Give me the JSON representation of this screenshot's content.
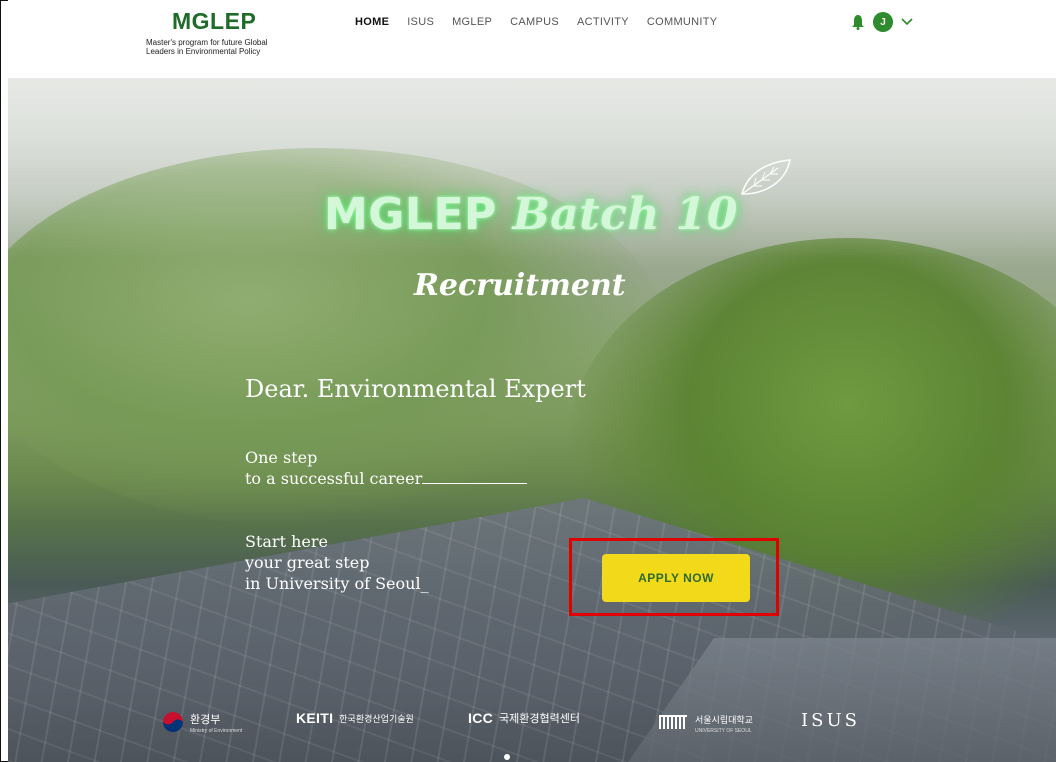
{
  "header": {
    "logo_title": "MGLEP",
    "logo_subtitle_line1": "Master's program for future Global",
    "logo_subtitle_line2": "Leaders in Environmental Policy",
    "nav": [
      {
        "label": "HOME",
        "active": true
      },
      {
        "label": "ISUS",
        "active": false
      },
      {
        "label": "MGLEP",
        "active": false
      },
      {
        "label": "CAMPUS",
        "active": false
      },
      {
        "label": "ACTIVITY",
        "active": false
      },
      {
        "label": "COMMUNITY",
        "active": false
      }
    ],
    "user_initial": "J",
    "icons": [
      "bell-icon",
      "avatar",
      "chevron-down-icon"
    ]
  },
  "hero": {
    "title_part1": "MGLEP",
    "title_part2": "Batch 10",
    "subtitle": "Recruitment",
    "greeting": "Dear. Environmental Expert",
    "step_line1": "One step",
    "step_line2": "to a successful career",
    "start_line1": "Start here",
    "start_line2": "your great step",
    "start_line3": "in University of Seoul_",
    "apply_label": "APPLY NOW"
  },
  "partners": {
    "moe_name": "환경부",
    "moe_sub": "Ministry of Environment",
    "keiti_name": "KEITI",
    "keiti_korean": "한국환경산업기술원",
    "icc_name": "ICC",
    "icc_korean": "국제환경협력센터",
    "uos_korean": "서울시립대학교",
    "uos_sub": "UNIVERSITY OF SEOUL",
    "isus_name": "ISUS"
  },
  "colors": {
    "brand_green": "#1f6b2a",
    "button_yellow": "#f2da1b",
    "highlight_red": "#e00000",
    "glow_green": "#8ff59a"
  }
}
